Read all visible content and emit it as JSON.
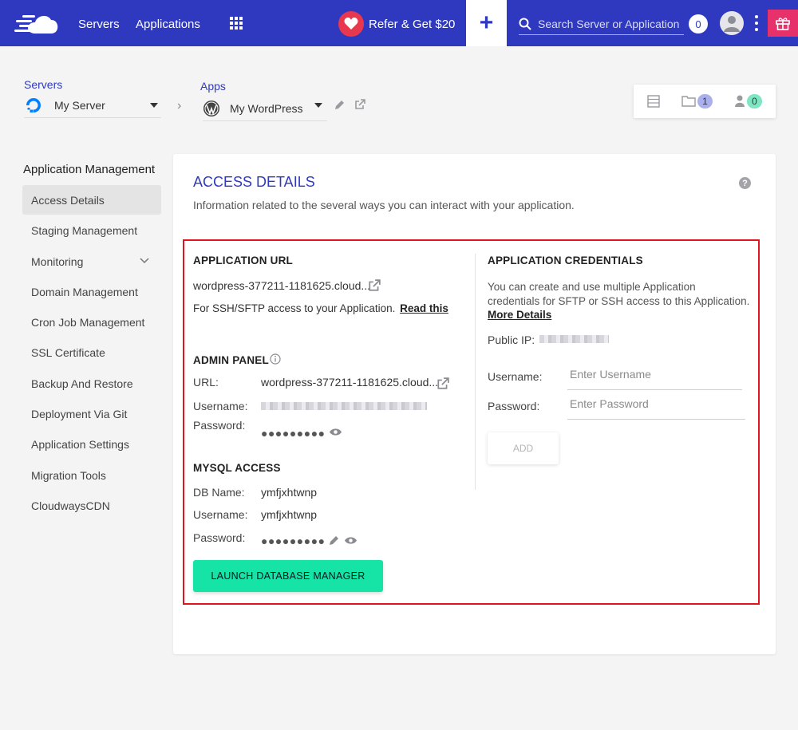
{
  "topbar": {
    "nav_servers": "Servers",
    "nav_applications": "Applications",
    "refer_label": "Refer & Get $20",
    "add_label": "+",
    "search_placeholder": "Search Server or Application",
    "notification_count": "0",
    "accent": "#2f39bf",
    "refer_color": "#e8384f",
    "gift_color": "#e7316b"
  },
  "breadcrumb": {
    "servers_label": "Servers",
    "server_name": "My Server",
    "apps_label": "Apps",
    "app_name": "My WordPress"
  },
  "stats": {
    "folders_count": "1",
    "users_count": "0"
  },
  "sidebar": {
    "title": "Application Management",
    "items": [
      {
        "label": "Access Details",
        "active": true
      },
      {
        "label": "Staging Management"
      },
      {
        "label": "Monitoring"
      },
      {
        "label": "Domain Management"
      },
      {
        "label": "Cron Job Management"
      },
      {
        "label": "SSL Certificate"
      },
      {
        "label": "Backup And Restore"
      },
      {
        "label": "Deployment Via Git"
      },
      {
        "label": "Application Settings"
      },
      {
        "label": "Migration Tools"
      },
      {
        "label": "CloudwaysCDN"
      }
    ]
  },
  "main": {
    "title": "ACCESS DETAILS",
    "description": "Information related to the several ways you can interact with your application.",
    "app_url": {
      "title": "APPLICATION URL",
      "url": "wordpress-377211-1181625.cloud...",
      "ssh_note": "For SSH/SFTP access to your Application.",
      "read_this": "Read this"
    },
    "admin_panel": {
      "title": "ADMIN PANEL",
      "url_label": "URL:",
      "url_value": "wordpress-377211-1181625.cloud...",
      "username_label": "Username:",
      "password_label": "Password:",
      "password_mask": "●●●●●●●●●"
    },
    "mysql": {
      "title": "MYSQL ACCESS",
      "db_name_label": "DB Name:",
      "db_name_value": "ymfjxhtwnp",
      "username_label": "Username:",
      "username_value": "ymfjxhtwnp",
      "password_label": "Password:",
      "password_mask": "●●●●●●●●●"
    },
    "credentials": {
      "title": "APPLICATION CREDENTIALS",
      "desc_line1": "You can create and use multiple Application",
      "desc_line2": "credentials for SFTP or SSH access to this Application.",
      "more_details": "More Details",
      "public_ip_label": "Public IP:",
      "username_label": "Username:",
      "username_placeholder": "Enter Username",
      "password_label": "Password:",
      "password_placeholder": "Enter Password",
      "add_label": "ADD"
    },
    "launch_label": "LAUNCH DATABASE MANAGER",
    "launch_color": "#16e3a6",
    "highlight_color": "#e0131f"
  }
}
